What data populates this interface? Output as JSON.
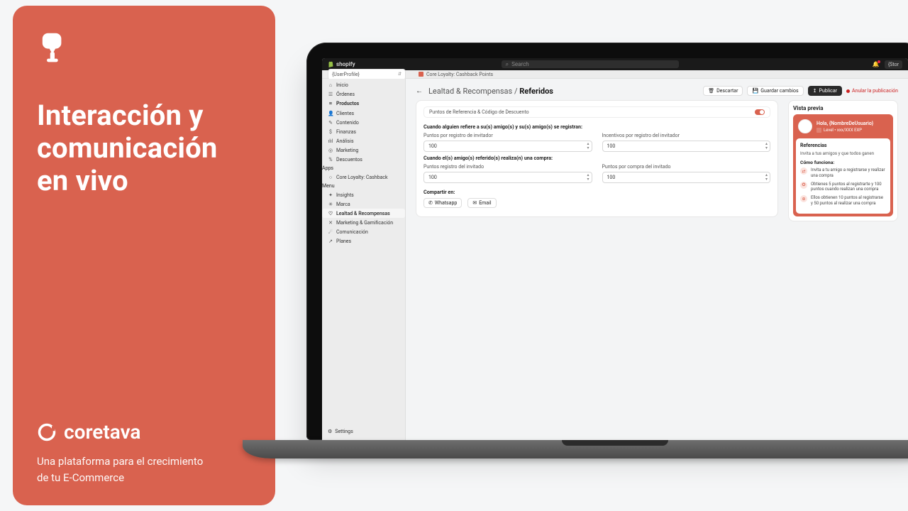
{
  "left_card": {
    "heading": "Interacción y comunicación en vivo",
    "brand": "coretava",
    "tagline": "Una plataforma para el crecimiento de tu E-Commerce"
  },
  "topbar": {
    "platform": "shopify",
    "search_placeholder": "Search",
    "store_label": "{Stor"
  },
  "crumb": {
    "app": "Core Loyalty: Cashback Points"
  },
  "sidebar": {
    "profile": "{UserProfile}",
    "main_nav": [
      {
        "icon": "⌂",
        "label": "Inicio"
      },
      {
        "icon": "☰",
        "label": "Órdenes"
      },
      {
        "icon": "⌗",
        "label": "Productos",
        "strong": true
      },
      {
        "icon": "👤",
        "label": "Clientes"
      },
      {
        "icon": "✎",
        "label": "Contenido"
      },
      {
        "icon": "$",
        "label": "Finanzas"
      },
      {
        "icon": "ılıl",
        "label": "Análisis"
      },
      {
        "icon": "◎",
        "label": "Marketing"
      },
      {
        "icon": "%",
        "label": "Descuentos"
      }
    ],
    "apps_header": "Apps",
    "apps": [
      {
        "icon": "○",
        "label": "Core Loyalty: Cashback"
      }
    ],
    "menu_header": "Menu",
    "menu": [
      {
        "icon": "✦",
        "label": "Insights"
      },
      {
        "icon": "✳",
        "label": "Marca"
      },
      {
        "icon": "♡",
        "label": "Lealtad & Recompensas",
        "active": true
      },
      {
        "icon": "✕",
        "label": "Marketing & Gamificación"
      },
      {
        "icon": "☄",
        "label": "Comunicación"
      },
      {
        "icon": "↗",
        "label": "Planes"
      }
    ],
    "settings": {
      "icon": "⚙",
      "label": "Settings"
    }
  },
  "header": {
    "path_a": "Lealtad & Recompensas",
    "sep": " / ",
    "path_b": "Referidos",
    "discard": "Descartar",
    "save": "Guardar cambios",
    "publish": "Publicar",
    "unpublish": "Anular la publicación"
  },
  "form": {
    "toggle_label": "Puntos de Referencia & Código de Descuento",
    "sect1_title": "Cuando alguien refiere a su(s) amigo(s) y su(s) amigo(s) se registran:",
    "f1a_label": "Puntos por registro de invitador",
    "f1a_value": "100",
    "f1b_label": "Incentivos por registro del invitador",
    "f1b_value": "100",
    "sect2_title": "Cuando el(s) amigo(s) referido(s) realiza(n) una compra:",
    "f2a_label": "Puntos registro del invitado",
    "f2a_value": "100",
    "f2b_label": "Puntos por compra del invitado",
    "f2b_value": "100",
    "share_label": "Compartir en:",
    "whatsapp": "Whatsapp",
    "email": "Email"
  },
  "preview": {
    "title": "Vista previa",
    "greet": "Hola, {NombreDeUsuario}",
    "level": "Level • xxx/XXX EXP",
    "ref_title": "Referencias",
    "ref_sub": "Invita a tus amigos y que todos ganen",
    "how_title": "Cómo funciona:",
    "bullets": [
      "Invita a tu amigo a registrarse y realizar una compra",
      "Obtienes 5 puntos al registrarte y 100 puntos cuando realizan una compra",
      "Ellos obtienen 10 puntos al registrarse y 50 puntos al realizar una compra"
    ]
  }
}
